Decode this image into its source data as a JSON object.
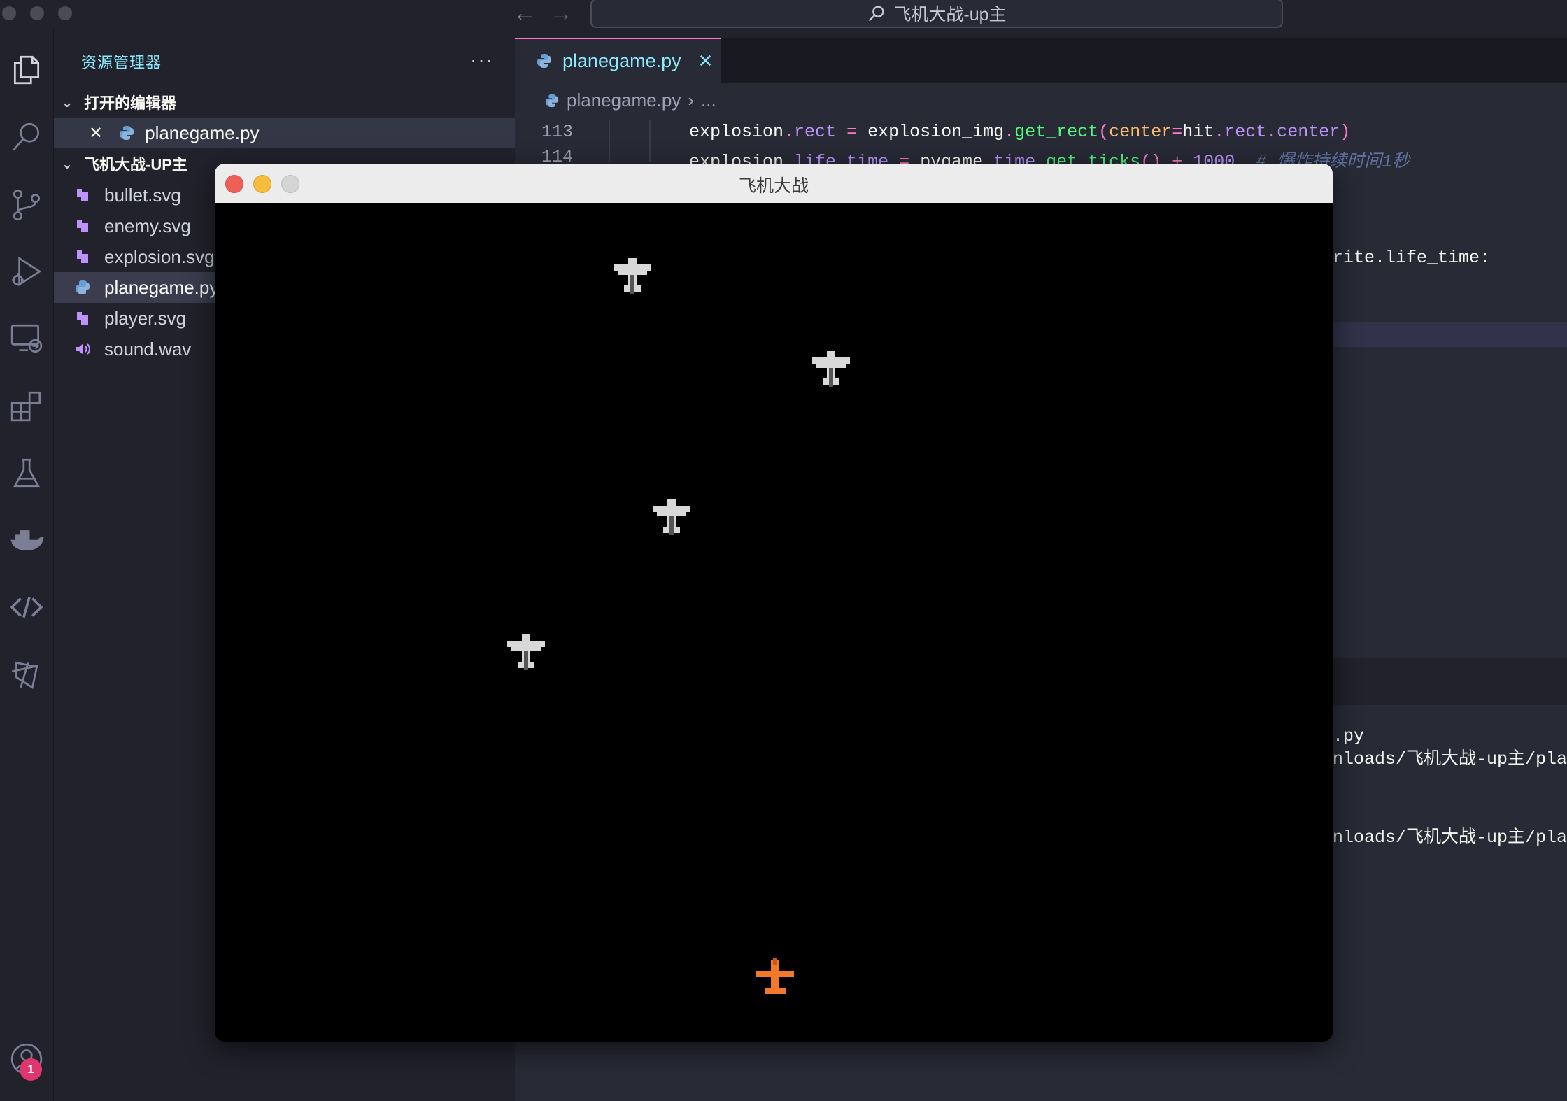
{
  "window": {
    "search_text": "飞机大战-up主",
    "back_glyph": "←",
    "forward_glyph": "→"
  },
  "activity_bar": {
    "items": [
      "explorer-icon",
      "search-icon",
      "source-control-icon",
      "run-debug-icon",
      "remote-explorer-icon",
      "extensions-icon",
      "testing-icon",
      "docker-icon",
      "remote-icon",
      "codeium-icon"
    ],
    "account_badge": "1"
  },
  "sidebar": {
    "title": "资源管理器",
    "more": "···",
    "open_editors_label": "打开的编辑器",
    "open_editors": [
      {
        "name": "planegame.py",
        "close": "✕"
      }
    ],
    "folder_label": "飞机大战-UP主",
    "files": [
      {
        "name": "bullet.svg",
        "icon": "svg-file-icon",
        "color": "#bd93f9"
      },
      {
        "name": "enemy.svg",
        "icon": "svg-file-icon",
        "color": "#bd93f9"
      },
      {
        "name": "explosion.svg",
        "icon": "svg-file-icon",
        "color": "#bd93f9"
      },
      {
        "name": "planegame.py",
        "icon": "python-file-icon",
        "color": "#6a9fd4",
        "selected": true
      },
      {
        "name": "player.svg",
        "icon": "svg-file-icon",
        "color": "#bd93f9"
      },
      {
        "name": "sound.wav",
        "icon": "audio-file-icon",
        "color": "#bd93f9"
      }
    ]
  },
  "editor": {
    "tab_label": "planegame.py",
    "tab_close": "✕",
    "breadcrumb_file": "planegame.py",
    "breadcrumb_sep": "›",
    "breadcrumb_more": "...",
    "lines": [
      {
        "num": "113"
      },
      {
        "num": "114"
      }
    ],
    "line113": {
      "a": "explosion",
      "b": ".",
      "c": "rect",
      "d": " = ",
      "e": "explosion_img",
      "f": ".",
      "g": "get_rect",
      "h": "(",
      "i": "center",
      "j": "=",
      "k": "hit",
      "l": ".",
      "m": "rect",
      "n": ".",
      "o": "center",
      "p": ")"
    },
    "line114": {
      "a": "explosion",
      "b": ".",
      "c": "life_time",
      "d": " = ",
      "e": "pygame",
      "f": ".",
      "g": "time",
      "h": ".",
      "i": "get_ticks",
      "j": "()",
      "k": " + ",
      "l": "1000",
      "m": "  # 爆炸持续时间1秒"
    },
    "partial_line": "rite.life_time:",
    "terminal": [
      ".py",
      "nloads/飞机大战-up主/pla",
      "nloads/飞机大战-up主/pla"
    ]
  },
  "game_window": {
    "title": "飞机大战",
    "enemy_color": "#d8d8d8",
    "player_color": "#f07a2a"
  }
}
